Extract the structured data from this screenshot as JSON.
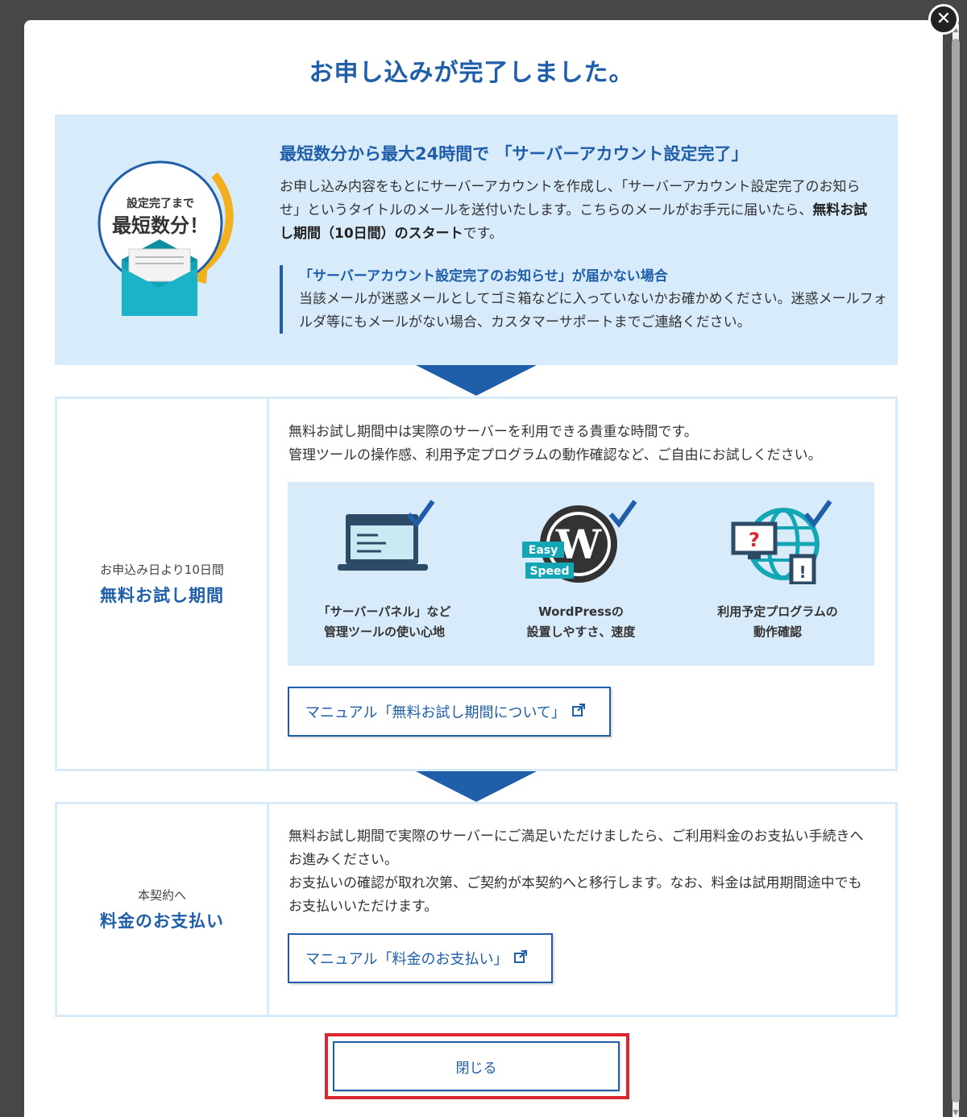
{
  "modal": {
    "title": "お申し込みが完了しました。",
    "close_icon_glyph": "✕"
  },
  "hero": {
    "badge_line1": "設定完了まで",
    "badge_line2": "最短数分！",
    "heading": "最短数分から最大24時間で 「サーバーアカウント設定完了」",
    "body_part1": "お申し込み内容をもとにサーバーアカウントを作成し、「サーバーアカウント設定完了のお知らせ」というタイトルのメールを送付いたします。こちらのメールがお手元に届いたら、",
    "body_bold": "無料お試し期間（10日間）のスタート",
    "body_part2": "です。",
    "note_title": "「サーバーアカウント設定完了のお知らせ」が届かない場合",
    "note_text": "当該メールが迷惑メールとしてゴミ箱などに入っていないかお確かめください。迷惑メールフォルダ等にもメールがない場合、カスタマーサポートまでご連絡ください。"
  },
  "step1": {
    "sub": "お申込み日より10日間",
    "title": "無料お試し期間",
    "text_line1": "無料お試し期間中は実際のサーバーを利用できる貴重な時間です。",
    "text_line2": "管理ツールの操作感、利用予定プログラムの動作確認など、ご自由にお試しください。",
    "features": [
      {
        "line1": "「サーバーパネル」など",
        "line2": "管理ツールの使い心地",
        "icon": "laptop-check-icon"
      },
      {
        "line1": "WordPressの",
        "line2": "設置しやすさ、速度",
        "icon": "wordpress-check-icon",
        "tag1": "Easy",
        "tag2": "Speed"
      },
      {
        "line1": "利用予定プログラムの",
        "line2": "動作確認",
        "icon": "globe-devices-check-icon"
      }
    ],
    "manual_label": "マニュアル「無料お試し期間について」"
  },
  "step2": {
    "sub": "本契約へ",
    "title": "料金のお支払い",
    "text_line1": "無料お試し期間で実際のサーバーにご満足いただけましたら、ご利用料金のお支払い手続きへお進みください。",
    "text_line2": "お支払いの確認が取れ次第、ご契約が本契約へと移行します。なお、料金は試用期間途中でもお支払いいただけます。",
    "manual_label": "マニュアル「料金のお支払い」"
  },
  "close_button": {
    "label": "閉じる"
  },
  "colors": {
    "accent": "#1f5ea8",
    "panel": "#d8ebfb",
    "highlight": "#d9262f"
  }
}
